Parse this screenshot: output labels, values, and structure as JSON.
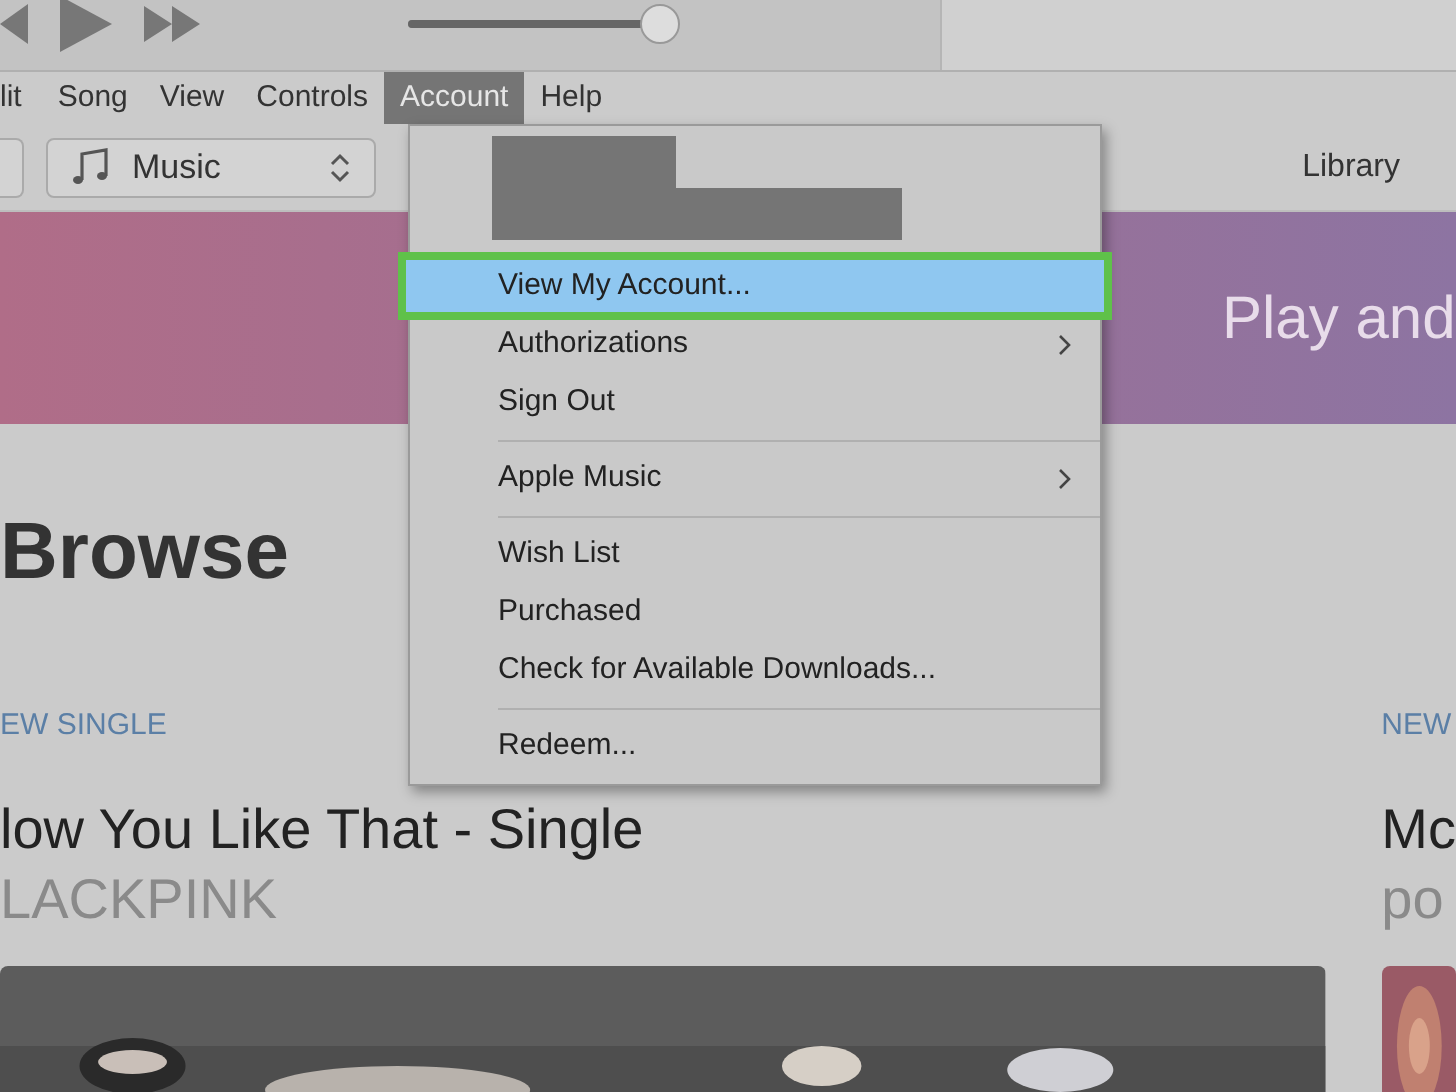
{
  "player": {
    "volume": {
      "level": 0.97
    }
  },
  "menu_bar": [
    {
      "label": "lit",
      "selected": false
    },
    {
      "label": "Song",
      "selected": false
    },
    {
      "label": "View",
      "selected": false
    },
    {
      "label": "Controls",
      "selected": false
    },
    {
      "label": "Account",
      "selected": true
    },
    {
      "label": "Help",
      "selected": false
    }
  ],
  "toolbar": {
    "media_picker": "Music",
    "library_tab": "Library"
  },
  "banner": {
    "subtitle": "Play and"
  },
  "account_menu": {
    "items": [
      {
        "kind": "item",
        "label": "View My Account...",
        "selected": true,
        "submenu": false
      },
      {
        "kind": "item",
        "label": "Authorizations",
        "selected": false,
        "submenu": true
      },
      {
        "kind": "item",
        "label": "Sign Out",
        "selected": false,
        "submenu": false
      },
      {
        "kind": "separator"
      },
      {
        "kind": "item",
        "label": "Apple Music",
        "selected": false,
        "submenu": true
      },
      {
        "kind": "separator"
      },
      {
        "kind": "item",
        "label": "Wish List",
        "selected": false,
        "submenu": false
      },
      {
        "kind": "item",
        "label": "Purchased",
        "selected": false,
        "submenu": false
      },
      {
        "kind": "item",
        "label": "Check for Available Downloads...",
        "selected": false,
        "submenu": false
      },
      {
        "kind": "separator"
      },
      {
        "kind": "item",
        "label": "Redeem...",
        "selected": false,
        "submenu": false
      }
    ]
  },
  "heading": "Browse",
  "features": [
    {
      "eyebrow": "EW SINGLE",
      "title": "low You Like That - Single",
      "artist": "LACKPINK"
    },
    {
      "eyebrow": "NEW",
      "title": "Mc",
      "artist": "po"
    }
  ]
}
